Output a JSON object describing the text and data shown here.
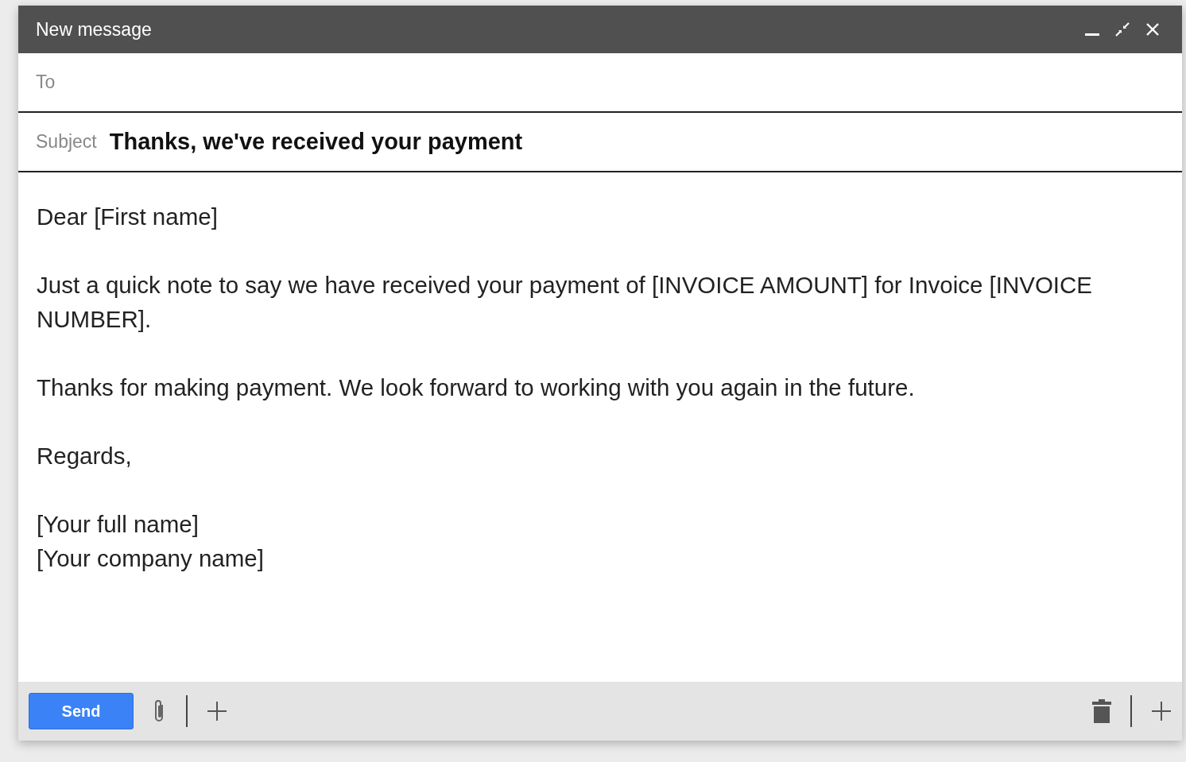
{
  "window": {
    "title": "New message"
  },
  "to": {
    "label": "To"
  },
  "subject": {
    "label": "Subject",
    "value": "Thanks, we've received your payment"
  },
  "body": {
    "paragraphs": [
      {
        "lines": [
          "Dear [First name]"
        ]
      },
      {
        "lines": [
          "Just a quick note to say we have received your payment of [INVOICE AMOUNT] for Invoice [INVOICE NUMBER]."
        ]
      },
      {
        "lines": [
          "Thanks for making payment. We look forward to working with you again in the future."
        ]
      },
      {
        "lines": [
          "Regards,"
        ]
      },
      {
        "lines": [
          "[Your full name]",
          "[Your company name]"
        ]
      }
    ]
  },
  "footer": {
    "send_label": "Send"
  }
}
